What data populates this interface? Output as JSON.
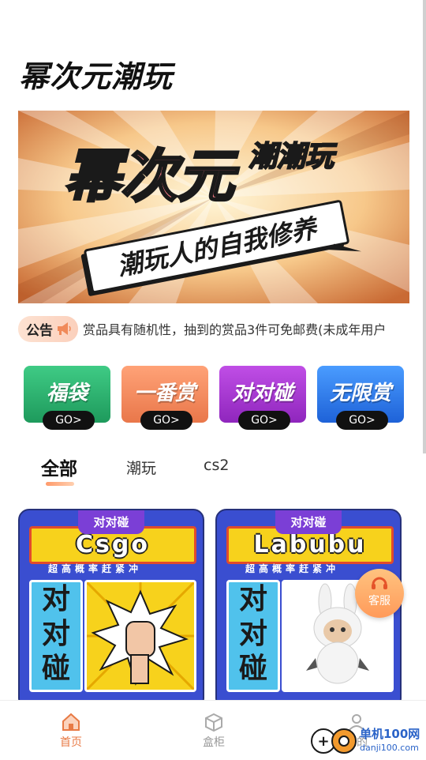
{
  "app": {
    "title": "幂次元潮玩"
  },
  "banner": {
    "line1": "幂次元",
    "line2": "潮潮玩",
    "slogan": "潮玩人的自我修养"
  },
  "notice": {
    "badge": "公告",
    "text": "赏品具有随机性，抽到的赏品3件可免邮费(未成年用户"
  },
  "categories": [
    {
      "label": "福袋",
      "go": "GO>",
      "color": "#27a96a"
    },
    {
      "label": "一番赏",
      "go": "GO>",
      "color": "#f08a5a"
    },
    {
      "label": "对对碰",
      "go": "GO>",
      "color": "#a034c8"
    },
    {
      "label": "无限赏",
      "go": "GO>",
      "color": "#2a7ce8"
    }
  ],
  "tabs": [
    {
      "label": "全部",
      "active": true
    },
    {
      "label": "潮玩",
      "active": false
    },
    {
      "label": "cs2",
      "active": false
    }
  ],
  "products": [
    {
      "badge": "对对碰",
      "name": "Csgo",
      "slogan": "超高概率赶紧冲",
      "side": "对对碰"
    },
    {
      "badge": "对对碰",
      "name": "Labubu",
      "slogan": "超高概率赶紧冲",
      "side": "对对碰"
    }
  ],
  "service": {
    "label": "客服"
  },
  "nav": [
    {
      "label": "首页",
      "icon": "home-icon",
      "active": true
    },
    {
      "label": "盒柜",
      "icon": "box-icon",
      "active": false
    },
    {
      "label": "我的",
      "icon": "user-icon",
      "active": false
    }
  ],
  "watermark": {
    "text": "单机100网",
    "url": "danji100.com"
  }
}
